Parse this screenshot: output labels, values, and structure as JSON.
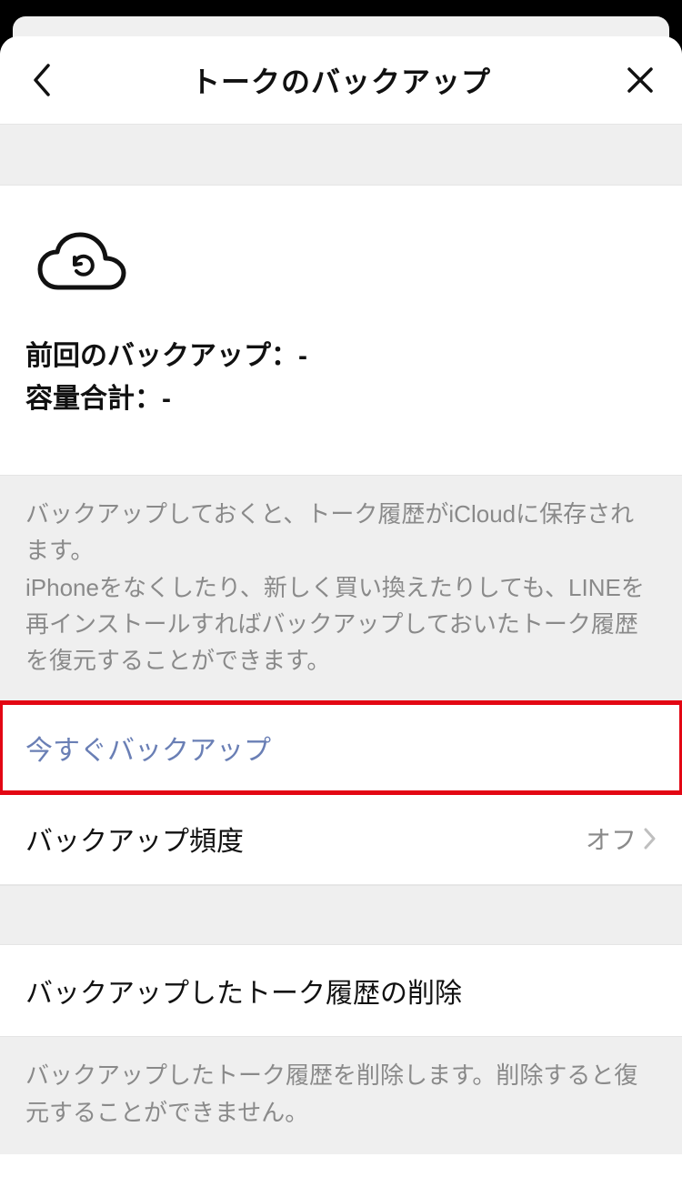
{
  "header": {
    "title": "トークのバックアップ"
  },
  "status": {
    "last_backup_label": "前回のバックアップ：",
    "last_backup_value": "-",
    "total_size_label": "容量合計：",
    "total_size_value": "-"
  },
  "description": {
    "text": "バックアップしておくと、トーク履歴がiCloudに保存されます。\niPhoneをなくしたり、新しく買い換えたりしても、LINEを再インストールすればバックアップしておいたトーク履歴を復元することができます。"
  },
  "actions": {
    "backup_now": "今すぐバックアップ",
    "frequency_label": "バックアップ頻度",
    "frequency_value": "オフ",
    "delete_label": "バックアップしたトーク履歴の削除"
  },
  "delete_description": {
    "text": "バックアップしたトーク履歴を削除します。削除すると復元することができません。"
  }
}
